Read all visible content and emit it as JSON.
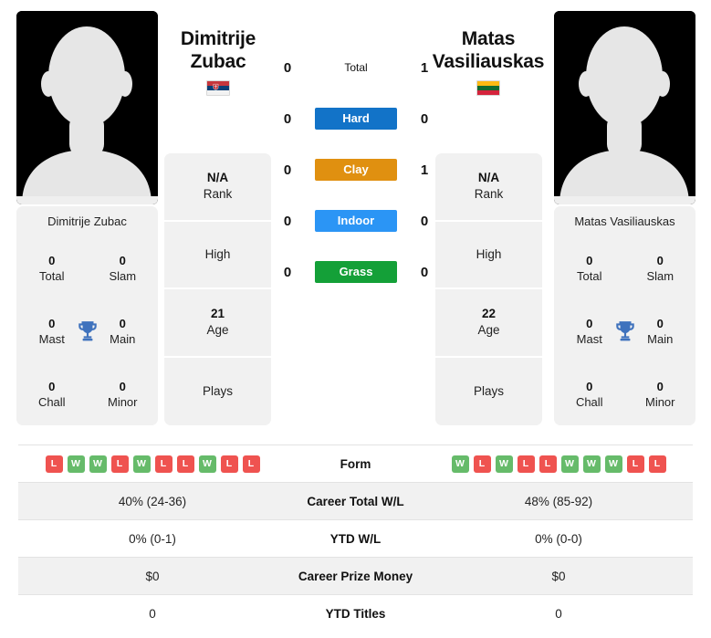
{
  "players": {
    "left": {
      "first_name": "Dimitrije",
      "last_name": "Zubac",
      "full_name": "Dimitrije Zubac",
      "flag": "serbia-flag",
      "avatar": "player-avatar-placeholder",
      "titles": [
        {
          "num": "0",
          "label": "Total"
        },
        {
          "num": "0",
          "label": "Slam"
        },
        {
          "num": "0",
          "label": "Mast"
        },
        {
          "num": "0",
          "label": "Main"
        },
        {
          "num": "0",
          "label": "Chall"
        },
        {
          "num": "0",
          "label": "Minor"
        }
      ],
      "info": [
        {
          "value": "N/A",
          "label": "Rank"
        },
        {
          "value": "",
          "label": "High"
        },
        {
          "value": "21",
          "label": "Age"
        },
        {
          "value": "",
          "label": "Plays"
        }
      ],
      "form": [
        "L",
        "W",
        "W",
        "L",
        "W",
        "L",
        "L",
        "W",
        "L",
        "L"
      ],
      "career_total_wl": "40% (24-36)",
      "ytd_wl": "0% (0-1)",
      "career_prize_money": "$0",
      "ytd_titles": "0"
    },
    "right": {
      "first_name": "Matas",
      "last_name": "Vasiliauskas",
      "full_name": "Matas Vasiliauskas",
      "flag": "lithuania-flag",
      "avatar": "player-avatar-placeholder",
      "titles": [
        {
          "num": "0",
          "label": "Total"
        },
        {
          "num": "0",
          "label": "Slam"
        },
        {
          "num": "0",
          "label": "Mast"
        },
        {
          "num": "0",
          "label": "Main"
        },
        {
          "num": "0",
          "label": "Chall"
        },
        {
          "num": "0",
          "label": "Minor"
        }
      ],
      "info": [
        {
          "value": "N/A",
          "label": "Rank"
        },
        {
          "value": "",
          "label": "High"
        },
        {
          "value": "22",
          "label": "Age"
        },
        {
          "value": "",
          "label": "Plays"
        }
      ],
      "form": [
        "W",
        "L",
        "W",
        "L",
        "L",
        "W",
        "W",
        "W",
        "L",
        "L"
      ],
      "career_total_wl": "48% (85-92)",
      "ytd_wl": "0% (0-0)",
      "career_prize_money": "$0",
      "ytd_titles": "0"
    }
  },
  "head_to_head": {
    "rows": [
      {
        "label": "Total",
        "left": "0",
        "right": "1",
        "color": "",
        "style": "plain"
      },
      {
        "label": "Hard",
        "left": "0",
        "right": "0",
        "color": "#1273c8",
        "style": "badge"
      },
      {
        "label": "Clay",
        "left": "0",
        "right": "1",
        "color": "#e09010",
        "style": "badge"
      },
      {
        "label": "Indoor",
        "left": "0",
        "right": "0",
        "color": "#2b95f5",
        "style": "badge"
      },
      {
        "label": "Grass",
        "left": "0",
        "right": "0",
        "color": "#14a038",
        "style": "badge"
      }
    ]
  },
  "stats_table": {
    "rows": [
      {
        "label": "Form",
        "type": "form"
      },
      {
        "label": "Career Total W/L",
        "type": "text",
        "left": "40% (24-36)",
        "right": "48% (85-92)"
      },
      {
        "label": "YTD W/L",
        "type": "text",
        "left": "0% (0-1)",
        "right": "0% (0-0)"
      },
      {
        "label": "Career Prize Money",
        "type": "text",
        "left": "$0",
        "right": "$0"
      },
      {
        "label": "YTD Titles",
        "type": "text",
        "left": "0",
        "right": "0"
      }
    ]
  },
  "colors": {
    "win": "#66bb6a",
    "loss": "#ef5350",
    "panel_bg": "#f1f1f1",
    "hard": "#1273c8",
    "clay": "#e09010",
    "indoor": "#2b95f5",
    "grass": "#14a038",
    "trophy": "#3f72bd"
  }
}
